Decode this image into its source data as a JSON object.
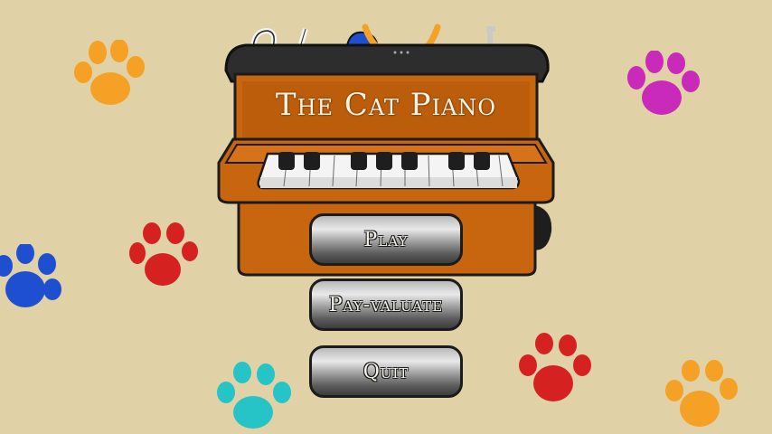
{
  "game": {
    "title": "The Cat Piano"
  },
  "menu": {
    "play_label": "Play",
    "payvaluate_label": "Pay-valuate",
    "quit_label": "Quit"
  },
  "colors": {
    "background": "#e0d2a6",
    "piano_body": "#c8650f",
    "piano_dark": "#2d2d2d",
    "paw_orange": "#f5a126",
    "paw_magenta": "#c92ab9",
    "paw_red": "#d62121",
    "paw_blue": "#1f4fd1",
    "paw_cyan": "#27c4c7"
  },
  "icons": [
    "paw-print-icon",
    "cat-paw-icon"
  ]
}
